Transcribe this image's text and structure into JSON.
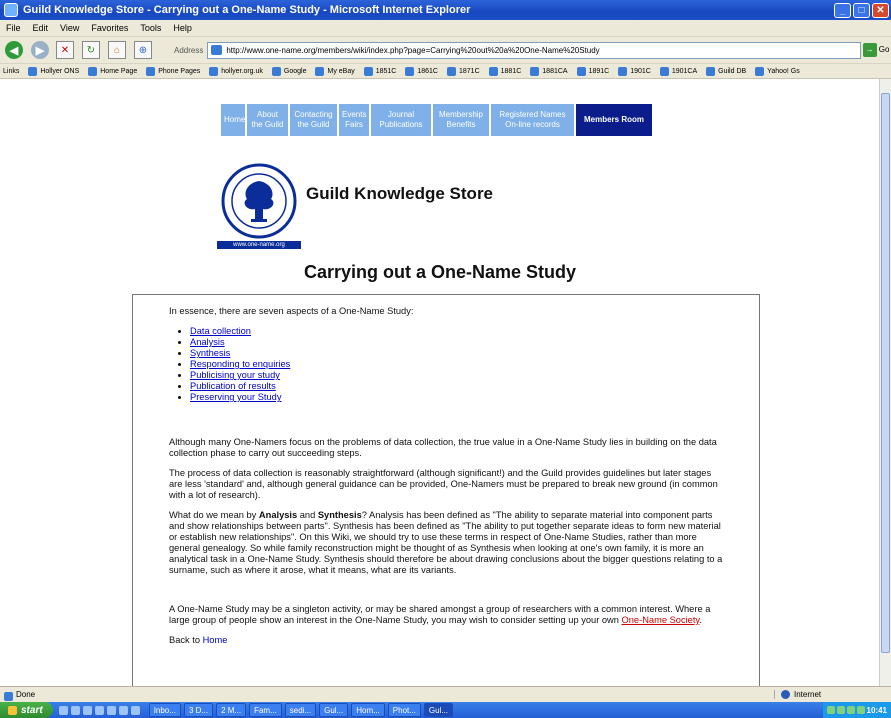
{
  "window": {
    "title": "Guild Knowledge Store - Carrying out a One-Name Study - Microsoft Internet Explorer"
  },
  "menu": [
    "File",
    "Edit",
    "View",
    "Favorites",
    "Tools",
    "Help"
  ],
  "address": {
    "label": "Address",
    "url": "http://www.one-name.org/members/wiki/index.php?page=Carrying%20out%20a%20One-Name%20Study",
    "go_label": "Go"
  },
  "links_bar": {
    "label": "Links",
    "items": [
      "Hollyer ONS",
      "Home Page",
      "Phone Pages",
      "hollyer.org.uk",
      "Google",
      "My eBay",
      "1851C",
      "1861C",
      "1871C",
      "1881C",
      "1881CA",
      "1891C",
      "1901C",
      "1901CA",
      "Guild DB",
      "Yahoo! Gs"
    ]
  },
  "site_nav": [
    {
      "line1": "Home",
      "line2": ""
    },
    {
      "line1": "About",
      "line2": "the Guild"
    },
    {
      "line1": "Contacting",
      "line2": "the Guild"
    },
    {
      "line1": "Events",
      "line2": "Fairs"
    },
    {
      "line1": "Journal",
      "line2": "Publications"
    },
    {
      "line1": "Membership",
      "line2": "Benefits"
    },
    {
      "line1": "Registered Names",
      "line2": "On-line records"
    },
    {
      "line1": "Members Room",
      "line2": ""
    }
  ],
  "logo": {
    "url_text": "www.one-name.org"
  },
  "store_title": "Guild Knowledge Store",
  "page_title": "Carrying out a One-Name Study",
  "content": {
    "intro": "In essence, there are seven aspects of a One-Name Study:",
    "aspects": [
      "Data collection",
      "Analysis",
      "Synthesis",
      "Responding to enquiries",
      "Publicising your study",
      "Publication of results",
      "Preserving your Study"
    ],
    "para1": "Although many One-Namers focus on the problems of data collection, the true value in a One-Name Study lies in building on the data collection phase to carry out succeeding steps.",
    "para2": "The process of data collection is reasonably straightforward (although significant!) and the Guild provides guidelines but later stages are less 'standard' and, although general guidance can be provided, One-Namers must be prepared to break new ground (in common with a lot of research).",
    "para3_a": "What do we mean by ",
    "para3_b1": "Analysis",
    "para3_c": " and ",
    "para3_b2": "Synthesis",
    "para3_d": "? Analysis has been defined as \"The ability to separate material into component parts and show relationships between parts\". Synthesis has been defined as \"The ability to put together separate ideas to form new material or establish new relationships\". On this Wiki, we should try to use these terms in respect of One-Name Studies, rather than more general genealogy. So while family reconstruction might be thought of as Synthesis when looking at one's own family, it is more an analytical task in a One-Name Study. Synthesis should therefore be about drawing conclusions about the bigger questions relating to a surname, such as where it arose, what it means, what are its variants.",
    "para4_a": "A One-Name Study may be a singleton activity, or may be shared amongst a group of researchers with a common interest. Where a large group of people show an interest in the One-Name Study, you may wish to consider setting up your own ",
    "para4_link": "One-Name Society",
    "para4_end": ".",
    "back_a": "Back to ",
    "back_link": "Home"
  },
  "status": {
    "left": "Done",
    "zone": "Internet"
  },
  "taskbar": {
    "start": "start",
    "tasks": [
      "Inbo...",
      "3 D...",
      "2 M...",
      "Fam...",
      "sedi...",
      "Gul...",
      "Hom...",
      "Phot...",
      "Gul..."
    ],
    "clock": "10:41"
  }
}
